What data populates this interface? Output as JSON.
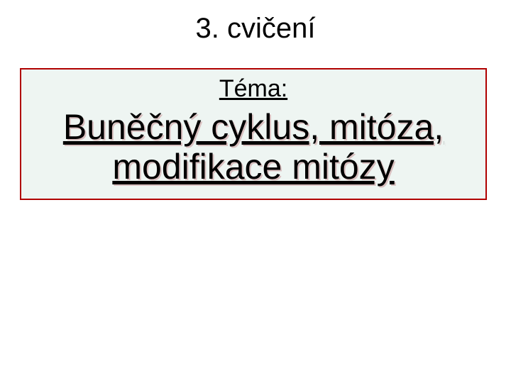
{
  "heading": "3. cvičení",
  "box": {
    "tema_label": "Téma:",
    "title_line1": "Buněčný cyklus, mitóza,",
    "title_line2": "modifikace mitózy"
  }
}
